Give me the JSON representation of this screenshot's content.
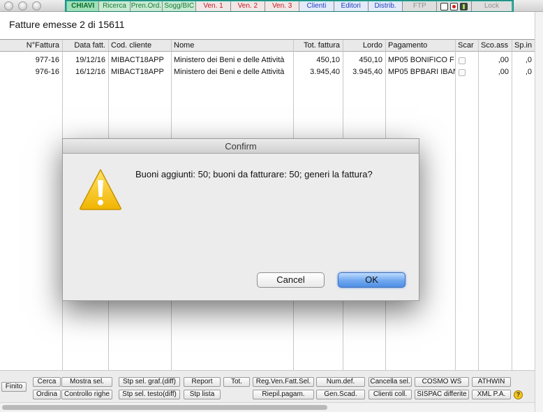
{
  "toolbar": {
    "items": [
      {
        "label": "CHIAVI",
        "style": "chiavi"
      },
      {
        "label": "Ricerca",
        "style": "green"
      },
      {
        "label": "Pren.Ord.",
        "style": "green"
      },
      {
        "label": "Sogg/BIC",
        "style": "green"
      },
      {
        "label": "Ven. 1",
        "style": "red"
      },
      {
        "label": "Ven. 2",
        "style": "red"
      },
      {
        "label": "Ven. 3",
        "style": "red"
      },
      {
        "label": "Clienti",
        "style": "blue"
      },
      {
        "label": "Editori",
        "style": "blue"
      },
      {
        "label": "Distrib.",
        "style": "blue"
      },
      {
        "label": "FTP",
        "style": "grey"
      },
      {
        "label": "",
        "style": "icons"
      },
      {
        "label": "Lock",
        "style": "grey"
      }
    ]
  },
  "page": {
    "title": "Fatture emesse 2 di 15611"
  },
  "table": {
    "headers": [
      "N°Fattura",
      "Data fatt.",
      "Cod. cliente",
      "Nome",
      "Tot. fattura",
      "Lordo",
      "Pagamento",
      "Scar",
      "Sco.ass",
      "Sp.in"
    ],
    "rows": [
      {
        "numero": "977-16",
        "data": "19/12/16",
        "cliente": "MIBACT18APP",
        "nome": "Ministero dei Beni e delle Attività",
        "totale": "450,10",
        "lordo": "450,10",
        "pagamento": "MP05  BONIFICO F",
        "scar": "",
        "sconto": ",00",
        "spese": ",0"
      },
      {
        "numero": "976-16",
        "data": "16/12/16",
        "cliente": "MIBACT18APP",
        "nome": "Ministero dei Beni e delle Attività",
        "totale": "3.945,40",
        "lordo": "3.945,40",
        "pagamento": "MP05  BPBARI IBAN",
        "scar": "",
        "sconto": ",00",
        "spese": ",0"
      }
    ]
  },
  "bottom": {
    "finito": "Finito",
    "cerca": "Cerca",
    "ordina": "Ordina",
    "mostra_sel": "Mostra sel.",
    "controllo_righe": "Controllo righe",
    "stp_sel_graf": "Stp sel. graf.(diff)",
    "stp_sel_testo": "Stp sel. testo(diff)",
    "report": "Report",
    "stp_lista": "Stp lista",
    "tot": "Tot.",
    "reg_ven": "Reg.Ven.Fatt.Sel.",
    "riepil_pagam": "Riepil.pagam.",
    "num_def": "Num.def.",
    "gen_scad": "Gen.Scad.",
    "cancella_sel": "Cancella sel.",
    "clienti_coll": "Clienti coll.",
    "cosmo_ws": "COSMO WS",
    "sispac": "SISPAC differite",
    "athwin": "ATHWIN",
    "xml_pa": "XML P.A.",
    "help": "?"
  },
  "dialog": {
    "title": "Confirm",
    "message": "Buoni aggiunti: 50; buoni da fatturare: 50; generi la fattura?",
    "cancel_label": "Cancel",
    "ok_label": "OK",
    "icon": "warning-icon"
  },
  "colors": {
    "toolbar_bg": "#2fb5a5",
    "ok_button": "#6fa7ee",
    "warning": "#f2c30f"
  }
}
